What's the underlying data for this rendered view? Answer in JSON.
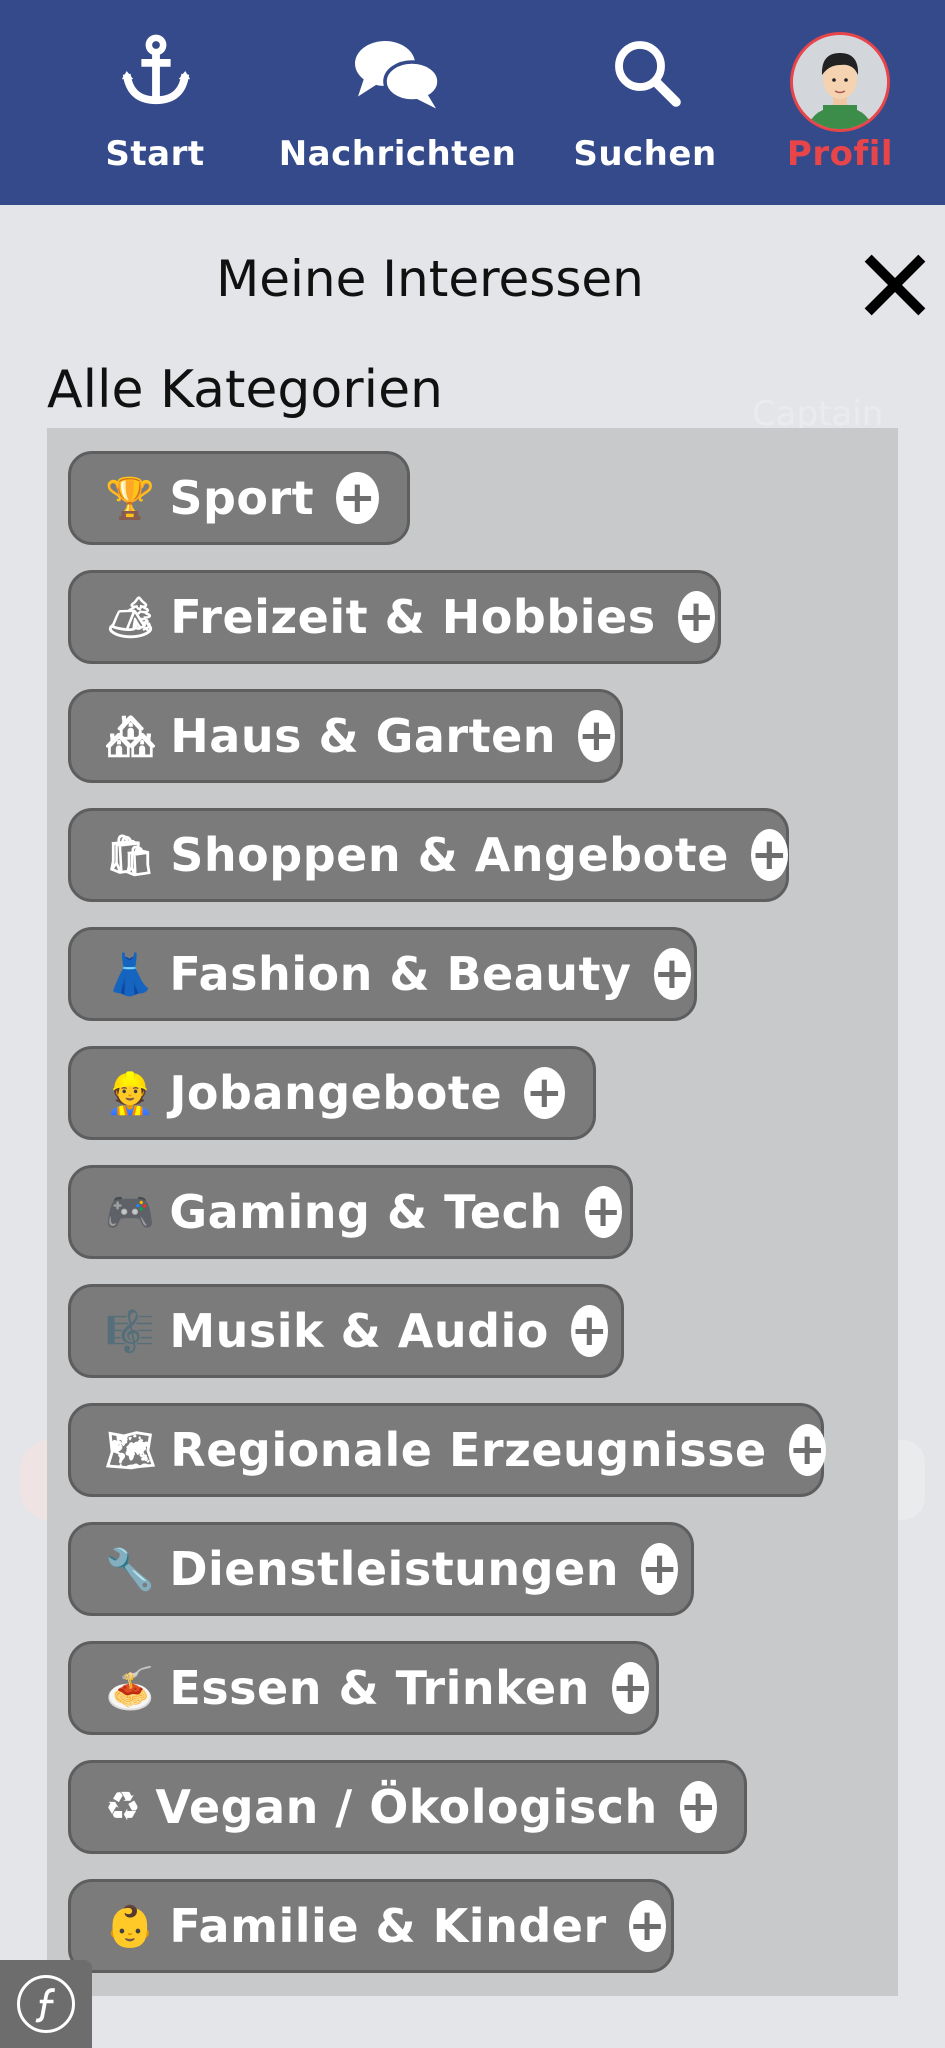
{
  "nav": {
    "items": [
      {
        "label": "Start",
        "icon": "anchor-icon",
        "active": false
      },
      {
        "label": "Nachrichten",
        "icon": "chat-bubbles-icon",
        "active": false
      },
      {
        "label": "Suchen",
        "icon": "search-icon",
        "active": false
      },
      {
        "label": "Profil",
        "icon": "avatar",
        "active": true
      }
    ],
    "colors": {
      "background": "#354a8a",
      "active": "#e8454a"
    }
  },
  "modal": {
    "title": "Meine Interessen",
    "section_title": "Alle Kategorien",
    "categories": [
      {
        "label": "Sport",
        "icon": "trophy-icon"
      },
      {
        "label": "Freizeit & Hobbies",
        "icon": "camping-icon"
      },
      {
        "label": "Haus & Garten",
        "icon": "houses-icon"
      },
      {
        "label": "Shoppen & Angebote",
        "icon": "shopping-bags-icon"
      },
      {
        "label": "Fashion & Beauty",
        "icon": "dress-icon"
      },
      {
        "label": "Jobangebote",
        "icon": "construction-worker-icon"
      },
      {
        "label": "Gaming & Tech",
        "icon": "game-controller-icon"
      },
      {
        "label": "Musik & Audio",
        "icon": "treble-clef-icon"
      },
      {
        "label": "Regionale Erzeugnisse",
        "icon": "world-map-icon"
      },
      {
        "label": "Dienstleistungen",
        "icon": "wrench-icon"
      },
      {
        "label": "Essen & Trinken",
        "icon": "spaghetti-icon"
      },
      {
        "label": "Vegan / Ökologisch",
        "icon": "recycle-icon"
      },
      {
        "label": "Familie & Kinder",
        "icon": "baby-icon"
      }
    ]
  },
  "background_ghost": {
    "captain": "Captain"
  }
}
